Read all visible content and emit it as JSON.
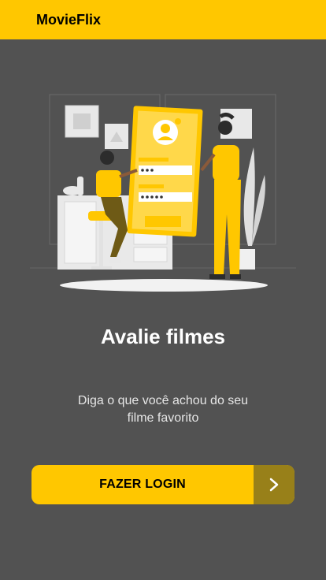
{
  "app": {
    "title": "MovieFlix"
  },
  "hero": {
    "heading": "Avalie filmes",
    "subtitle": "Diga o que você achou do seu filme favorito"
  },
  "login": {
    "label": "FAZER LOGIN",
    "icon": "chevron-right-icon"
  },
  "colors": {
    "accent": "#FFC700",
    "background": "#525252",
    "accent_dark": "#988019"
  }
}
